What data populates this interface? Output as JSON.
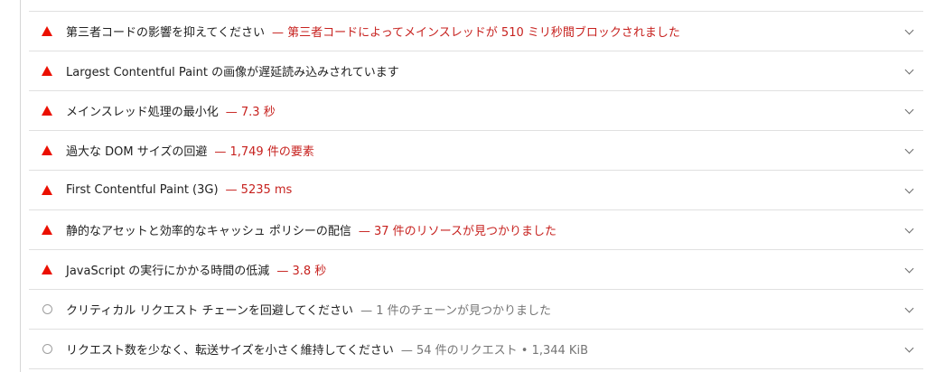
{
  "audits": [
    {
      "status": "fail",
      "icon": "warning-triangle-icon",
      "title": "第三者コードの影響を抑えてください",
      "display": "— 第三者コードによってメインスレッドが 510 ミリ秒間ブロックされました"
    },
    {
      "status": "fail",
      "icon": "warning-triangle-icon",
      "title": "Largest Contentful Paint の画像が遅延読み込みされています",
      "display": ""
    },
    {
      "status": "fail",
      "icon": "warning-triangle-icon",
      "title": "メインスレッド処理の最小化",
      "display": "— 7.3 秒"
    },
    {
      "status": "fail",
      "icon": "warning-triangle-icon",
      "title": "過大な DOM サイズの回避",
      "display": "— 1,749 件の要素"
    },
    {
      "status": "fail",
      "icon": "warning-triangle-icon",
      "title": "First Contentful Paint (3G)",
      "display": "— 5235 ms"
    },
    {
      "status": "fail",
      "icon": "warning-triangle-icon",
      "title": "静的なアセットと効率的なキャッシュ ポリシーの配信",
      "display": "— 37 件のリソースが見つかりました"
    },
    {
      "status": "fail",
      "icon": "warning-triangle-icon",
      "title": "JavaScript の実行にかかる時間の低減",
      "display": "— 3.8 秒"
    },
    {
      "status": "info",
      "icon": "info-circle-icon",
      "title": "クリティカル リクエスト チェーンを回避してください",
      "display": "— 1 件のチェーンが見つかりました"
    },
    {
      "status": "info",
      "icon": "info-circle-icon",
      "title": "リクエスト数を少なく、転送サイズを小さく維持してください",
      "display": "— 54 件のリクエスト • 1,344 KiB"
    }
  ],
  "colors": {
    "fail": "#eb0f00",
    "fail_text": "#c7221f",
    "info": "#9e9e9e",
    "info_text": "#757575"
  }
}
